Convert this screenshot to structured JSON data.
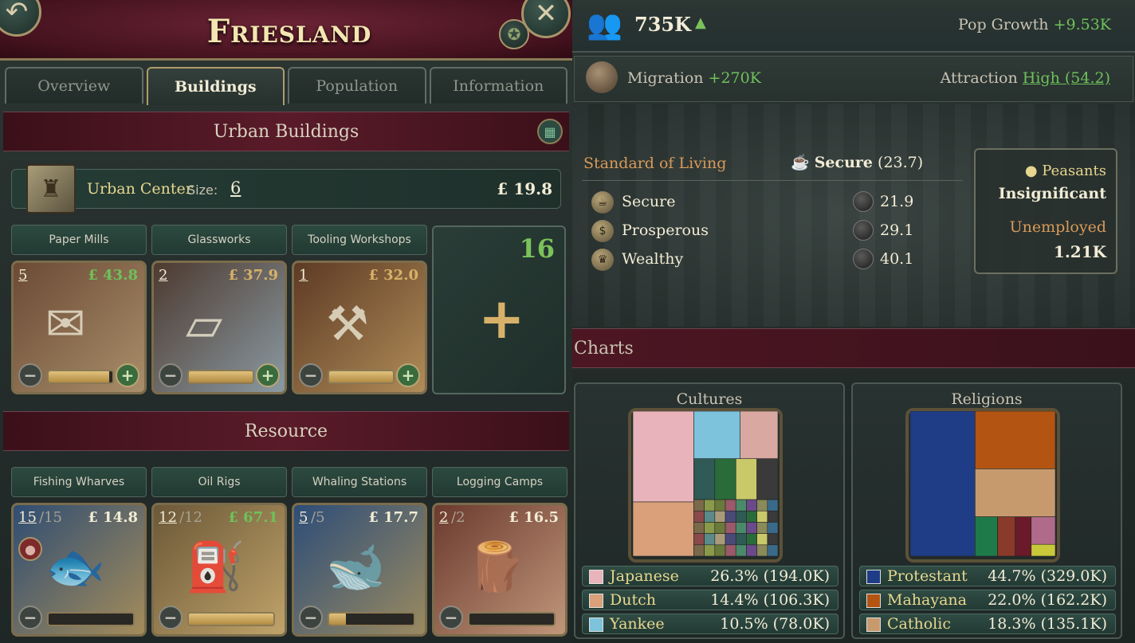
{
  "state": {
    "title": "Friesland",
    "back_icon": "back-arrow-icon",
    "close_icon": "close-icon",
    "favorite_icon": "star-icon"
  },
  "tabs": [
    "Overview",
    "Buildings",
    "Population",
    "Information"
  ],
  "active_tab": "Buildings",
  "urban": {
    "heading": "Urban Buildings",
    "center_label": "Urban Center",
    "size_label": "Size:",
    "size_value": "6",
    "money": "£ 19.8"
  },
  "urban_buildings": [
    {
      "name": "Paper Mills",
      "level": "5",
      "income": "£ 43.8",
      "income_color": "#6fc15a",
      "fill": 0.95,
      "icon": "paper-icon"
    },
    {
      "name": "Glassworks",
      "level": "2",
      "income": "£ 37.9",
      "income_color": "#d7b169",
      "fill": 1.0,
      "icon": "glass-icon"
    },
    {
      "name": "Tooling Workshops",
      "level": "1",
      "income": "£ 32.0",
      "income_color": "#d7b169",
      "fill": 1.0,
      "icon": "tools-icon"
    }
  ],
  "add_card": {
    "count": "16",
    "icon": "plus-icon"
  },
  "resource": {
    "heading": "Resource",
    "buildings": [
      {
        "name": "Fishing Wharves",
        "level": "15",
        "max": "15",
        "income": "£ 14.8",
        "income_color": "#f2ecd6",
        "fill": 0.0,
        "icon": "fish-icon"
      },
      {
        "name": "Oil Rigs",
        "level": "12",
        "max": "12",
        "income": "£ 67.1",
        "income_color": "#6fc15a",
        "fill": 1.0,
        "icon": "oil-icon"
      },
      {
        "name": "Whaling Stations",
        "level": "5",
        "max": "5",
        "income": "£ 17.7",
        "income_color": "#f2ecd6",
        "fill": 0.2,
        "icon": "whale-icon"
      },
      {
        "name": "Logging Camps",
        "level": "2",
        "max": "2",
        "income": "£ 16.5",
        "income_color": "#f2ecd6",
        "fill": 0.0,
        "icon": "logs-icon"
      }
    ]
  },
  "population": {
    "value": "735K",
    "growth_label": "Pop Growth",
    "growth_value": "+9.53K",
    "migration_label": "Migration",
    "migration_value": "+270K",
    "attraction_label": "Attraction",
    "attraction_value": "High (54.2)"
  },
  "sol": {
    "title": "Standard of Living",
    "current": "Secure",
    "current_value": "(23.7)",
    "rows": [
      {
        "name": "Secure",
        "value": "21.9"
      },
      {
        "name": "Prosperous",
        "value": "29.1"
      },
      {
        "name": "Wealthy",
        "value": "40.1"
      }
    ]
  },
  "peasants": {
    "label": "Peasants",
    "status": "Insignificant",
    "unemployed_label": "Unemployed",
    "unemployed_value": "1.21K"
  },
  "charts_heading": "Charts",
  "chart_data": [
    {
      "type": "treemap",
      "title": "Cultures",
      "series": [
        {
          "name": "Japanese",
          "pct": 26.3,
          "value": "194.0K",
          "color": "#e8b3ba"
        },
        {
          "name": "Dutch",
          "pct": 14.4,
          "value": "106.3K",
          "color": "#d9a07a"
        },
        {
          "name": "Yankee",
          "pct": 10.5,
          "value": "78.0K",
          "color": "#7cc3db"
        }
      ]
    },
    {
      "type": "treemap",
      "title": "Religions",
      "series": [
        {
          "name": "Protestant",
          "pct": 44.7,
          "value": "329.0K",
          "color": "#1f3d86"
        },
        {
          "name": "Mahayana",
          "pct": 22.0,
          "value": "162.2K",
          "color": "#b35412"
        },
        {
          "name": "Catholic",
          "pct": 18.3,
          "value": "135.1K",
          "color": "#c79a6e"
        }
      ]
    }
  ],
  "legend_text": {
    "cultures": [
      "26.3% (194.0K)",
      "14.4% (106.3K)",
      "10.5% (78.0K)"
    ],
    "religions": [
      "44.7% (329.0K)",
      "22.0% (162.2K)",
      "18.3% (135.1K)"
    ]
  }
}
